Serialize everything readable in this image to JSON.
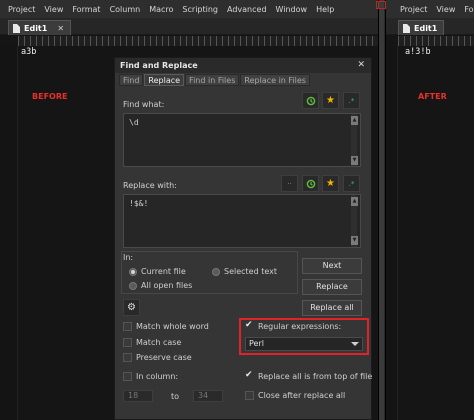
{
  "left_window": {
    "menu": [
      "Project",
      "View",
      "Format",
      "Column",
      "Macro",
      "Scripting",
      "Advanced",
      "Window",
      "Help"
    ],
    "tab": {
      "label": "Edit1",
      "close": "✕"
    },
    "editor_text": "a3b",
    "side_label": "BEFORE"
  },
  "right_window": {
    "menu": [
      "Project",
      "View",
      "Format"
    ],
    "tab": {
      "label": "Edit1"
    },
    "editor_text": "a!3!b",
    "side_label": "AFTER"
  },
  "dialog": {
    "title": "Find and Replace",
    "close": "✕",
    "tabs": [
      {
        "label": "Find",
        "active": false
      },
      {
        "label": "Replace",
        "active": true
      },
      {
        "label": "Find in Files",
        "active": false
      },
      {
        "label": "Replace in Files",
        "active": false
      }
    ],
    "find_what_label": "Find what:",
    "find_what_value": "\\d",
    "replace_with_label": "Replace with:",
    "replace_with_value": "!$&!",
    "in_label": "In:",
    "scope_options": {
      "current_file": "Current file",
      "selected_text": "Selected text",
      "all_open_files": "All open files"
    },
    "buttons": {
      "next": "Next",
      "replace": "Replace",
      "replace_all": "Replace all"
    },
    "options": {
      "match_whole_word": "Match whole word",
      "match_case": "Match case",
      "preserve_case": "Preserve case",
      "in_column": "In column:",
      "regular_expressions": "Regular expressions:",
      "regex_engine": "Perl",
      "replace_all_from_top": "Replace all is from top of file",
      "close_after_replace_all": "Close after replace all"
    },
    "column_from": "18",
    "column_to_label": "to",
    "column_to": "34"
  },
  "colors": {
    "accent_red": "#e0232b",
    "star_gold": "#f0b400",
    "history_green": "#5fbf3a",
    "regex_green": "#35c060"
  }
}
